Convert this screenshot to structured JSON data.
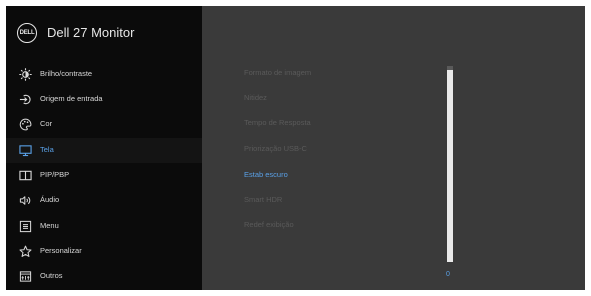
{
  "monitor": {
    "brand_logo": "DELL",
    "title": "Dell 27 Monitor"
  },
  "menu": [
    {
      "label": "Brilho/contraste",
      "icon": "brightness-icon",
      "name": "brightness-contrast",
      "active": false
    },
    {
      "label": "Origem de entrada",
      "icon": "input-source-icon",
      "name": "input-source",
      "active": false
    },
    {
      "label": "Cor",
      "icon": "color-icon",
      "name": "color",
      "active": false
    },
    {
      "label": "Tela",
      "icon": "display-icon",
      "name": "display",
      "active": true
    },
    {
      "label": "PIP/PBP",
      "icon": "pip-pbp-icon",
      "name": "pip-pbp",
      "active": false
    },
    {
      "label": "Áudio",
      "icon": "audio-icon",
      "name": "audio",
      "active": false
    },
    {
      "label": "Menu",
      "icon": "menu-icon",
      "name": "menu",
      "active": false
    },
    {
      "label": "Personalizar",
      "icon": "star-icon",
      "name": "personalize",
      "active": false
    },
    {
      "label": "Outros",
      "icon": "others-icon",
      "name": "others",
      "active": false
    }
  ],
  "submenu": [
    {
      "label": "Formato de imagem",
      "name": "aspect-ratio",
      "active": false
    },
    {
      "label": "Nitidez",
      "name": "sharpness",
      "active": false
    },
    {
      "label": "Tempo de Resposta",
      "name": "response-time",
      "active": false
    },
    {
      "label": "Priorização USB-C",
      "name": "usb-c-prioritization",
      "active": false
    },
    {
      "label": "Estab escuro",
      "name": "dark-stabilizer",
      "active": true
    },
    {
      "label": "Smart HDR",
      "name": "smart-hdr",
      "active": false
    },
    {
      "label": "Redef exibição",
      "name": "reset-display",
      "active": false
    }
  ],
  "slider": {
    "value": "0",
    "fill_fraction": 0.98
  },
  "colors": {
    "accent": "#5aa0e6",
    "sidebar_bg": "#0b0b0b",
    "panel_bg": "#3a3a3a"
  }
}
